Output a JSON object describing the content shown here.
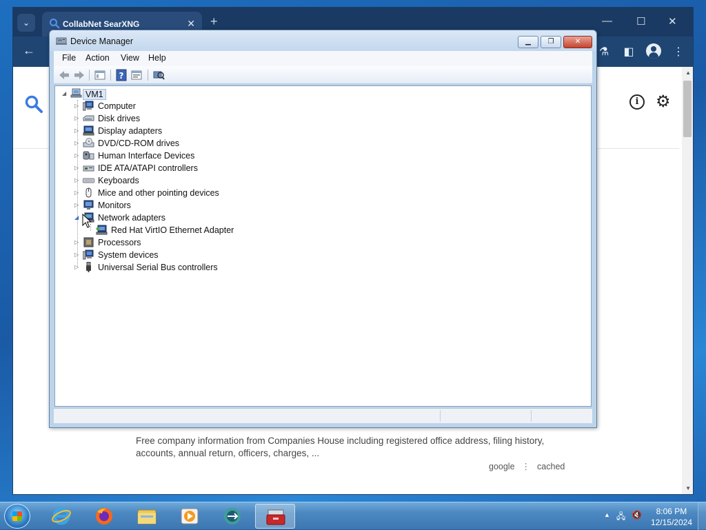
{
  "browser": {
    "tab_title": "CollabNet SearXNG",
    "tab_close": "✕",
    "new_tab": "+",
    "window_controls": {
      "minimize": "—",
      "maximize": "☐",
      "close": "✕"
    }
  },
  "search_page": {
    "snippet": "Free company information from Companies House including registered office address, filing history, accounts, annual return, officers, charges, ...",
    "links": [
      "google",
      "cached"
    ]
  },
  "device_manager": {
    "title": "Device Manager",
    "menu": [
      "File",
      "Action",
      "View",
      "Help"
    ],
    "root": "VM1",
    "categories": [
      {
        "label": "Computer",
        "icon": "computer-icon"
      },
      {
        "label": "Disk drives",
        "icon": "disk-drive-icon"
      },
      {
        "label": "Display adapters",
        "icon": "display-adapter-icon"
      },
      {
        "label": "DVD/CD-ROM drives",
        "icon": "dvd-drive-icon"
      },
      {
        "label": "Human Interface Devices",
        "icon": "hid-icon"
      },
      {
        "label": "IDE ATA/ATAPI controllers",
        "icon": "ide-controller-icon"
      },
      {
        "label": "Keyboards",
        "icon": "keyboard-icon"
      },
      {
        "label": "Mice and other pointing devices",
        "icon": "mouse-icon"
      },
      {
        "label": "Monitors",
        "icon": "monitor-icon"
      },
      {
        "label": "Network adapters",
        "icon": "network-adapter-icon",
        "expanded": true,
        "children": [
          "Red Hat VirtIO Ethernet Adapter"
        ]
      },
      {
        "label": "Processors",
        "icon": "processor-icon"
      },
      {
        "label": "System devices",
        "icon": "system-devices-icon"
      },
      {
        "label": "Universal Serial Bus controllers",
        "icon": "usb-icon"
      }
    ]
  },
  "taskbar": {
    "apps": [
      "internet-explorer-icon",
      "firefox-icon",
      "file-explorer-icon",
      "media-player-icon",
      "teamviewer-icon",
      "toolbox-icon"
    ],
    "clock_time": "8:06 PM",
    "clock_date": "12/15/2024"
  },
  "colors": {
    "browser_chrome": "#1a3a63",
    "window_frame": "#bcd3ea",
    "taskbar": "#4b87c0"
  }
}
